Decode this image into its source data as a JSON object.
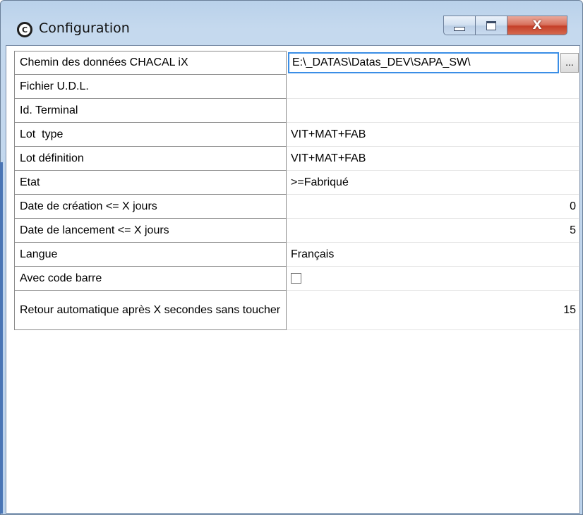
{
  "window": {
    "title": "Configuration",
    "app_icon_glyph": "C",
    "close_glyph": "X"
  },
  "settings": [
    {
      "label": "Chemin des données CHACAL iX",
      "value": "E:\\_DATAS\\Datas_DEV\\SAPA_SW\\",
      "editor": "text-with-browse",
      "browse_label": "..."
    },
    {
      "label": "Fichier U.D.L.",
      "value": ""
    },
    {
      "label": "Id. Terminal",
      "value": ""
    },
    {
      "label": "Lot  type",
      "value": "VIT+MAT+FAB"
    },
    {
      "label": "Lot définition",
      "value": "VIT+MAT+FAB"
    },
    {
      "label": "Etat",
      "value": ">=Fabriqué"
    },
    {
      "label": "Date de création <= X jours",
      "value": "0",
      "align": "right"
    },
    {
      "label": "Date de lancement <= X jours",
      "value": "5",
      "align": "right"
    },
    {
      "label": "Langue",
      "value": "Français"
    },
    {
      "label": "Avec code barre",
      "value": "",
      "editor": "checkbox",
      "checked": false
    },
    {
      "label": "Retour automatique après X secondes sans toucher",
      "value": "15",
      "align": "right"
    }
  ]
}
